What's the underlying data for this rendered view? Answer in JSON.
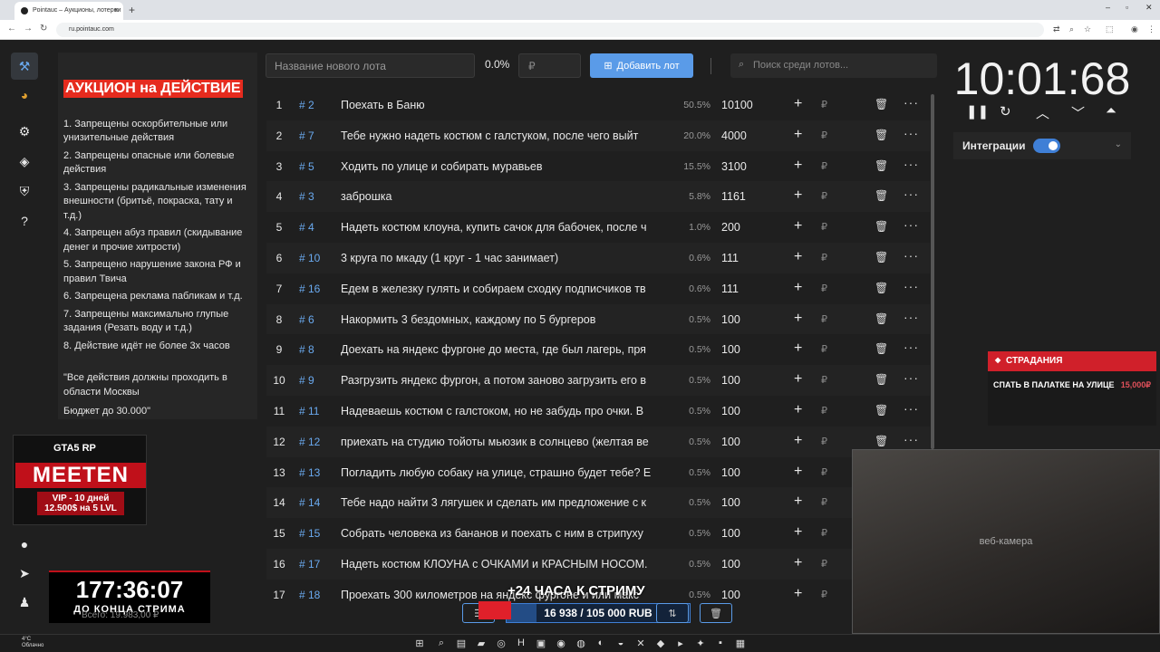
{
  "browser": {
    "tab_title": "Pointauc – Аукционы, лотереи",
    "url": "ru.pointauc.com"
  },
  "colors": {
    "accent": "#5a9be8",
    "danger": "#e0202a",
    "background": "#1f1f1f"
  },
  "sidebar": {
    "items": [
      {
        "name": "hammer",
        "icon": "hammer-icon"
      },
      {
        "name": "wheel",
        "icon": "pie-wheel-icon"
      },
      {
        "name": "settings",
        "icon": "gear-icon"
      },
      {
        "name": "layers",
        "icon": "layers-icon"
      },
      {
        "name": "shield",
        "icon": "shield-icon"
      },
      {
        "name": "help",
        "icon": "help-icon"
      },
      {
        "name": "github",
        "icon": "github-icon"
      },
      {
        "name": "telegram",
        "icon": "telegram-icon"
      },
      {
        "name": "profile",
        "icon": "profile-icon"
      }
    ]
  },
  "rules": {
    "title": "АУКЦИОН на ДЕЙСТВИЕ",
    "items": [
      "1. Запрещены оскорбительные или унизительные действия",
      "2. Запрещены опасные или болевые действия",
      "3. Запрещены радикальные изменения внешности (бритьё, покраска, тату и т.д.)",
      "4. Запрещен абуз правил (скидывание денег и прочие хитрости)",
      "5. Запрещено нарушение закона РФ и правил Твича",
      "6. Запрещена реклама пабликам и т.д.",
      "7.  Запрещены максимально глупые задания (Резать воду и т.д.)",
      "8. Действие идёт не более 3х часов"
    ],
    "note": "\"Все действия должны проходить в области Москвы",
    "budget": "Бюджет до 30.000\""
  },
  "promo": {
    "brand": "GTA5 RP",
    "title": "MEETEN",
    "subtitle": "VIP - 10 дней 12.500$ на 5 LVL"
  },
  "stream_timer": {
    "value": "177:36:07",
    "label": "ДО КОНЦА СТРИМА",
    "total": "Всего: 19.983,00 ₽"
  },
  "toolbar": {
    "lot_placeholder": "Название нового лота",
    "percent": "0.0%",
    "amount_placeholder": "₽",
    "add_label": "Добавить лот",
    "search_placeholder": "Поиск среди лотов..."
  },
  "lots": [
    {
      "n": "1",
      "id": "# 2",
      "name": "Поехать в Баню",
      "pct": "50.5%",
      "amount": "10100"
    },
    {
      "n": "2",
      "id": "# 7",
      "name": "Тебе нужно надеть костюм с галстуком, после чего выйт",
      "pct": "20.0%",
      "amount": "4000"
    },
    {
      "n": "3",
      "id": "# 5",
      "name": "Ходить по улице и собирать муравьев",
      "pct": "15.5%",
      "amount": "3100"
    },
    {
      "n": "4",
      "id": "# 3",
      "name": "заброшка",
      "pct": "5.8%",
      "amount": "1161"
    },
    {
      "n": "5",
      "id": "# 4",
      "name": "Надеть костюм клоуна, купить сачок для бабочек, после ч",
      "pct": "1.0%",
      "amount": "200"
    },
    {
      "n": "6",
      "id": "# 10",
      "name": "3 круга по мкаду (1 круг - 1 час занимает)",
      "pct": "0.6%",
      "amount": "111"
    },
    {
      "n": "7",
      "id": "# 16",
      "name": "Едем в железку гулять и собираем сходку подписчиков тв",
      "pct": "0.6%",
      "amount": "111"
    },
    {
      "n": "8",
      "id": "# 6",
      "name": "Накормить 3 бездомных, каждому по 5 бургеров",
      "pct": "0.5%",
      "amount": "100"
    },
    {
      "n": "9",
      "id": "# 8",
      "name": "Доехать на яндекс фургоне до места, где был лагерь, пря",
      "pct": "0.5%",
      "amount": "100"
    },
    {
      "n": "10",
      "id": "# 9",
      "name": "Разгрузить яндекс фургон, а потом заново загрузить его в",
      "pct": "0.5%",
      "amount": "100"
    },
    {
      "n": "11",
      "id": "# 11",
      "name": "Надеваешь костюм с галстоком, но не забудь про очки. В",
      "pct": "0.5%",
      "amount": "100"
    },
    {
      "n": "12",
      "id": "# 12",
      "name": "приехать на студию тойоты мьюзик в солнцево (желтая ве",
      "pct": "0.5%",
      "amount": "100"
    },
    {
      "n": "13",
      "id": "# 13",
      "name": "Погладить любую собаку на улице, страшно будет тебе? Е",
      "pct": "0.5%",
      "amount": "100"
    },
    {
      "n": "14",
      "id": "# 14",
      "name": "Тебе надо найти 3 лягушек и сделать им предложение с к",
      "pct": "0.5%",
      "amount": "100"
    },
    {
      "n": "15",
      "id": "# 15",
      "name": "Собрать человека из бананов и поехать с ним в стрипуху",
      "pct": "0.5%",
      "amount": "100"
    },
    {
      "n": "16",
      "id": "# 17",
      "name": "Надеть костюм КЛОУНА с ОЧКАМИ и КРАСНЫМ НОСОМ.",
      "pct": "0.5%",
      "amount": "100"
    },
    {
      "n": "17",
      "id": "# 18",
      "name": "Проехать 300 километров на яндекс фургоне и или макс",
      "pct": "0.5%",
      "amount": "100"
    }
  ],
  "lot_actions": {
    "plus": "+",
    "currency": "₽",
    "more": "···"
  },
  "main_timer": {
    "value": "10:01:68"
  },
  "integrations": {
    "label": "Интеграции",
    "enabled": true
  },
  "suffering": {
    "header": "СТРАДАНИЯ",
    "item": "СПАТЬ В ПАЛАТКЕ НА УЛИЦЕ",
    "price": "15,000₽"
  },
  "webcam_label": "веб-камера",
  "goal": {
    "overlay": "+24 ЧАСА К СТРИМУ",
    "text": "16 938 / 105 000 RUB",
    "progress": 0.161
  },
  "taskbar": {
    "weather_temp": "4°C",
    "weather_desc": "Облачно"
  }
}
